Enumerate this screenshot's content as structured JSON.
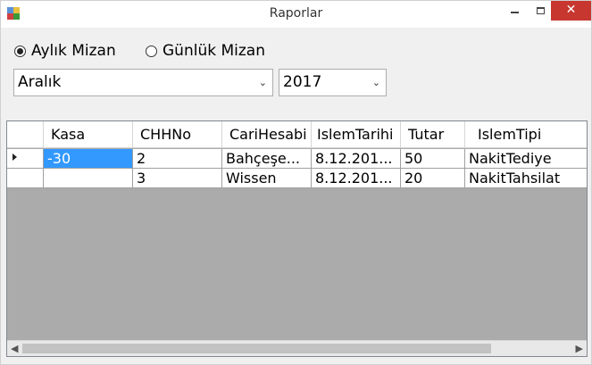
{
  "window": {
    "title": "Raporlar",
    "minimize_label": "",
    "maximize_label": "",
    "close_label": "✕"
  },
  "report_type": {
    "options": [
      {
        "label": "Aylık Mizan",
        "checked": true
      },
      {
        "label": "Günlük Mizan",
        "checked": false
      }
    ]
  },
  "filters": {
    "month": {
      "value": "Aralık"
    },
    "year": {
      "value": "2017"
    }
  },
  "grid": {
    "columns": [
      "Kasa",
      "CHHNo",
      "CariHesabi",
      "IslemTarihi",
      "Tutar",
      "IslemTipi"
    ],
    "rows": [
      {
        "current": true,
        "cells": [
          "-30",
          "2",
          "Bahçeşe...",
          "8.12.201...",
          "50",
          "NakitTediye"
        ]
      },
      {
        "current": false,
        "cells": [
          "",
          "3",
          "Wissen",
          "8.12.201...",
          "20",
          "NakitTahsilat"
        ]
      }
    ],
    "selected_cell": {
      "row": 0,
      "col": 0
    }
  },
  "colors": {
    "selection": "#3399ff",
    "grid_background": "#ababab",
    "close_button": "#c7372f"
  }
}
